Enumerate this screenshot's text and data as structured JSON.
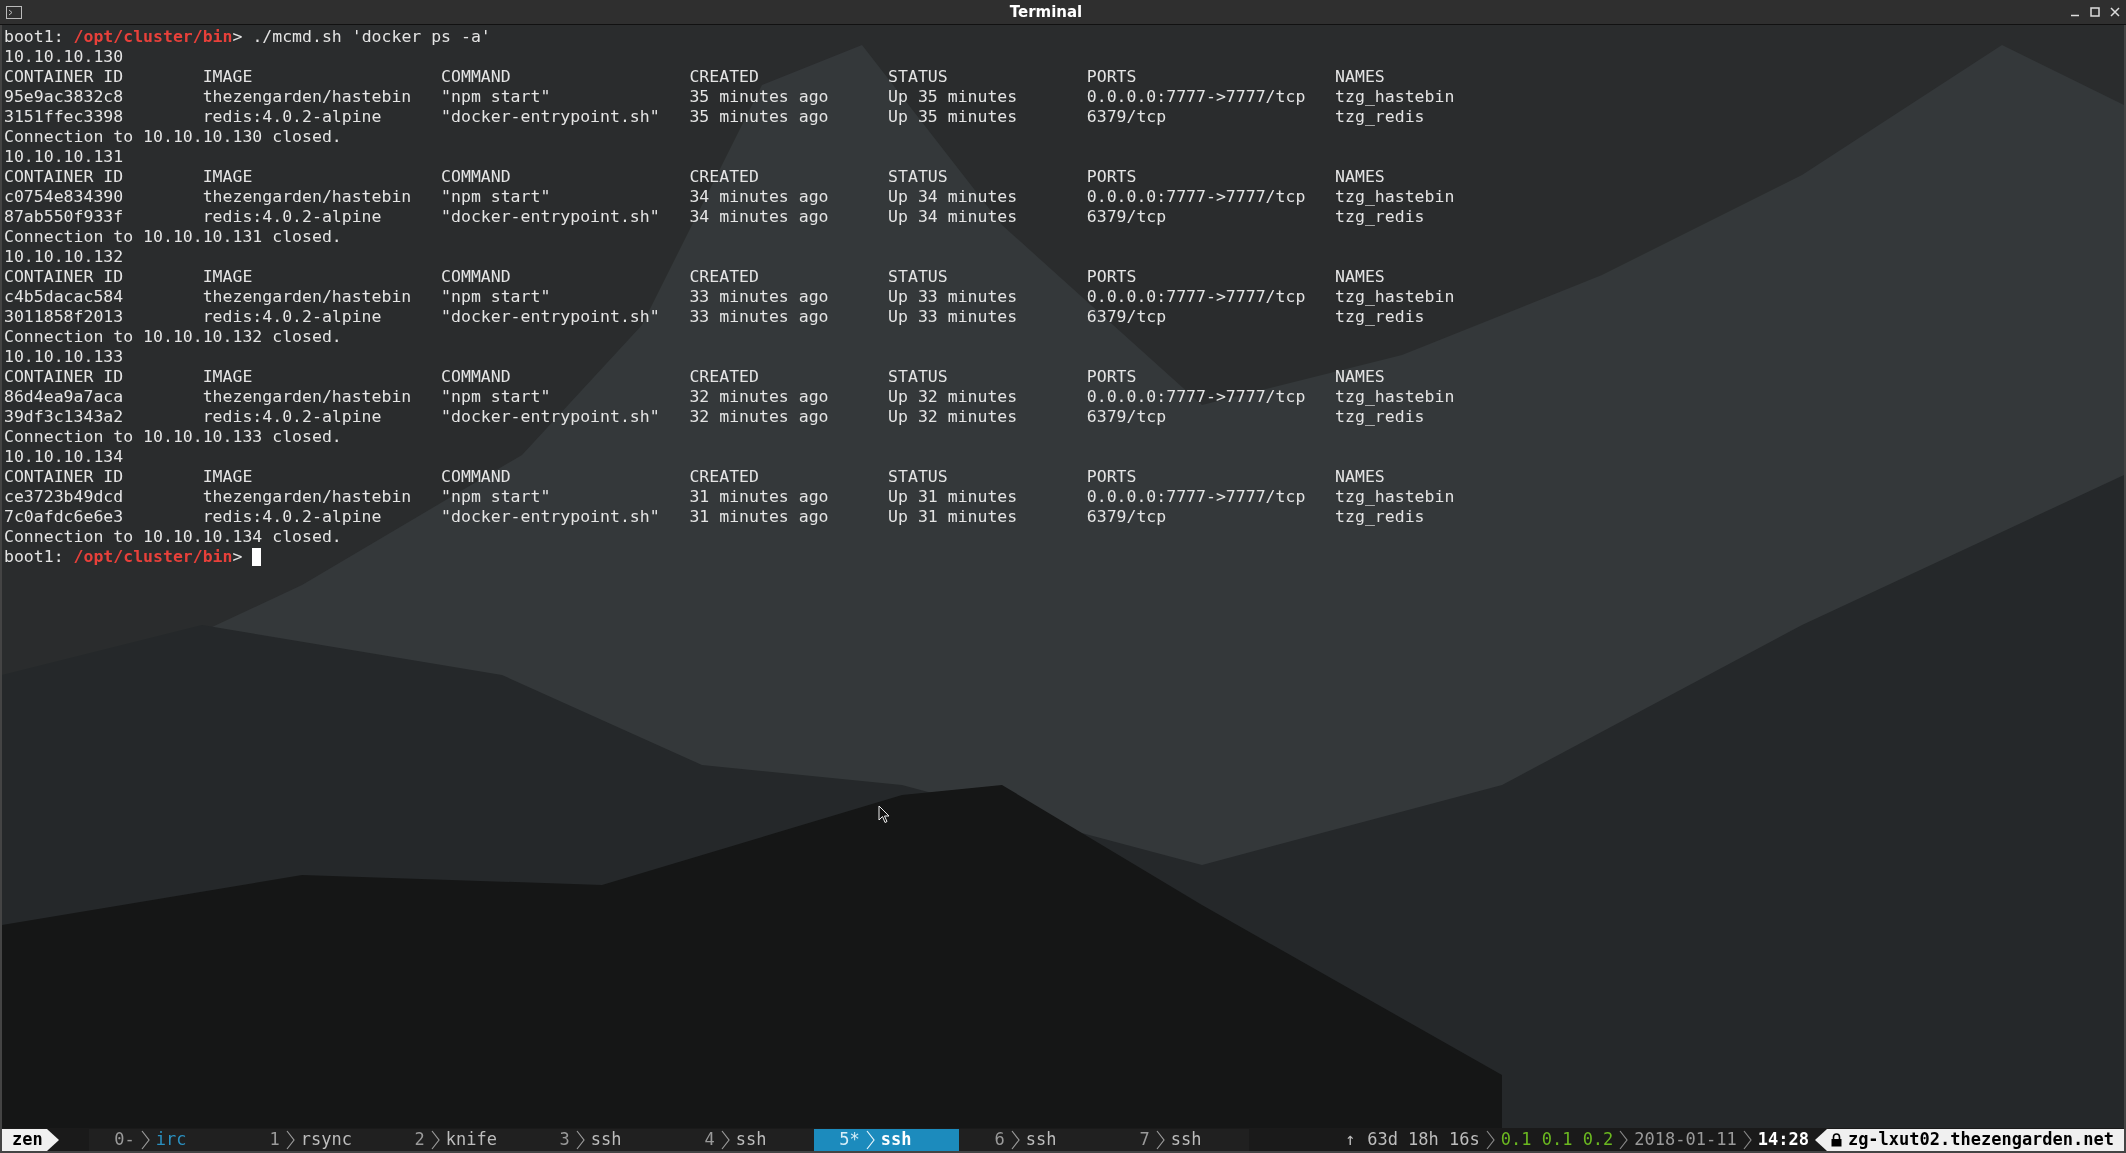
{
  "window": {
    "title": "Terminal"
  },
  "prompt": {
    "host": "boot1:",
    "path": "/opt/cluster/bin",
    "symbol": ">",
    "command": "./mcmd.sh 'docker ps -a'"
  },
  "blocks": [
    {
      "host": "10.10.10.130",
      "columns": [
        "CONTAINER ID",
        "IMAGE",
        "COMMAND",
        "CREATED",
        "STATUS",
        "PORTS",
        "NAMES"
      ],
      "rows": [
        [
          "95e9ac3832c8",
          "thezengarden/hastebin",
          "\"npm start\"",
          "35 minutes ago",
          "Up 35 minutes",
          "0.0.0.0:7777->7777/tcp",
          "tzg_hastebin"
        ],
        [
          "3151ffec3398",
          "redis:4.0.2-alpine",
          "\"docker-entrypoint.sh\"",
          "35 minutes ago",
          "Up 35 minutes",
          "6379/tcp",
          "tzg_redis"
        ]
      ],
      "closed": "Connection to 10.10.10.130 closed."
    },
    {
      "host": "10.10.10.131",
      "columns": [
        "CONTAINER ID",
        "IMAGE",
        "COMMAND",
        "CREATED",
        "STATUS",
        "PORTS",
        "NAMES"
      ],
      "rows": [
        [
          "c0754e834390",
          "thezengarden/hastebin",
          "\"npm start\"",
          "34 minutes ago",
          "Up 34 minutes",
          "0.0.0.0:7777->7777/tcp",
          "tzg_hastebin"
        ],
        [
          "87ab550f933f",
          "redis:4.0.2-alpine",
          "\"docker-entrypoint.sh\"",
          "34 minutes ago",
          "Up 34 minutes",
          "6379/tcp",
          "tzg_redis"
        ]
      ],
      "closed": "Connection to 10.10.10.131 closed."
    },
    {
      "host": "10.10.10.132",
      "columns": [
        "CONTAINER ID",
        "IMAGE",
        "COMMAND",
        "CREATED",
        "STATUS",
        "PORTS",
        "NAMES"
      ],
      "rows": [
        [
          "c4b5dacac584",
          "thezengarden/hastebin",
          "\"npm start\"",
          "33 minutes ago",
          "Up 33 minutes",
          "0.0.0.0:7777->7777/tcp",
          "tzg_hastebin"
        ],
        [
          "3011858f2013",
          "redis:4.0.2-alpine",
          "\"docker-entrypoint.sh\"",
          "33 minutes ago",
          "Up 33 minutes",
          "6379/tcp",
          "tzg_redis"
        ]
      ],
      "closed": "Connection to 10.10.10.132 closed."
    },
    {
      "host": "10.10.10.133",
      "columns": [
        "CONTAINER ID",
        "IMAGE",
        "COMMAND",
        "CREATED",
        "STATUS",
        "PORTS",
        "NAMES"
      ],
      "rows": [
        [
          "86d4ea9a7aca",
          "thezengarden/hastebin",
          "\"npm start\"",
          "32 minutes ago",
          "Up 32 minutes",
          "0.0.0.0:7777->7777/tcp",
          "tzg_hastebin"
        ],
        [
          "39df3c1343a2",
          "redis:4.0.2-alpine",
          "\"docker-entrypoint.sh\"",
          "32 minutes ago",
          "Up 32 minutes",
          "6379/tcp",
          "tzg_redis"
        ]
      ],
      "closed": "Connection to 10.10.10.133 closed."
    },
    {
      "host": "10.10.10.134",
      "columns": [
        "CONTAINER ID",
        "IMAGE",
        "COMMAND",
        "CREATED",
        "STATUS",
        "PORTS",
        "NAMES"
      ],
      "rows": [
        [
          "ce3723b49dcd",
          "thezengarden/hastebin",
          "\"npm start\"",
          "31 minutes ago",
          "Up 31 minutes",
          "0.0.0.0:7777->7777/tcp",
          "tzg_hastebin"
        ],
        [
          "7c0afdc6e6e3",
          "redis:4.0.2-alpine",
          "\"docker-entrypoint.sh\"",
          "31 minutes ago",
          "Up 31 minutes",
          "6379/tcp",
          "tzg_redis"
        ]
      ],
      "closed": "Connection to 10.10.10.134 closed."
    }
  ],
  "prompt_end": {
    "host": "boot1:",
    "path": "/opt/cluster/bin",
    "symbol": ">"
  },
  "status_bar": {
    "session": "zen",
    "windows": [
      {
        "index": "0-",
        "name": "irc",
        "selected": false,
        "highlighted": true
      },
      {
        "index": "1",
        "name": "rsync",
        "selected": false,
        "highlighted": false
      },
      {
        "index": "2",
        "name": "knife",
        "selected": false,
        "highlighted": false
      },
      {
        "index": "3",
        "name": "ssh",
        "selected": false,
        "highlighted": false
      },
      {
        "index": "4",
        "name": "ssh",
        "selected": false,
        "highlighted": false
      },
      {
        "index": "5*",
        "name": "ssh",
        "selected": true,
        "highlighted": false
      },
      {
        "index": "6",
        "name": "ssh",
        "selected": false,
        "highlighted": false
      },
      {
        "index": "7",
        "name": "ssh",
        "selected": false,
        "highlighted": false
      }
    ],
    "arrow": "↑",
    "uptime": "63d 18h 16s",
    "load": "0.1 0.1 0.2",
    "date": "2018-01-11",
    "time": "14:28",
    "hostname": "zg-lxut02.thezengarden.net"
  }
}
